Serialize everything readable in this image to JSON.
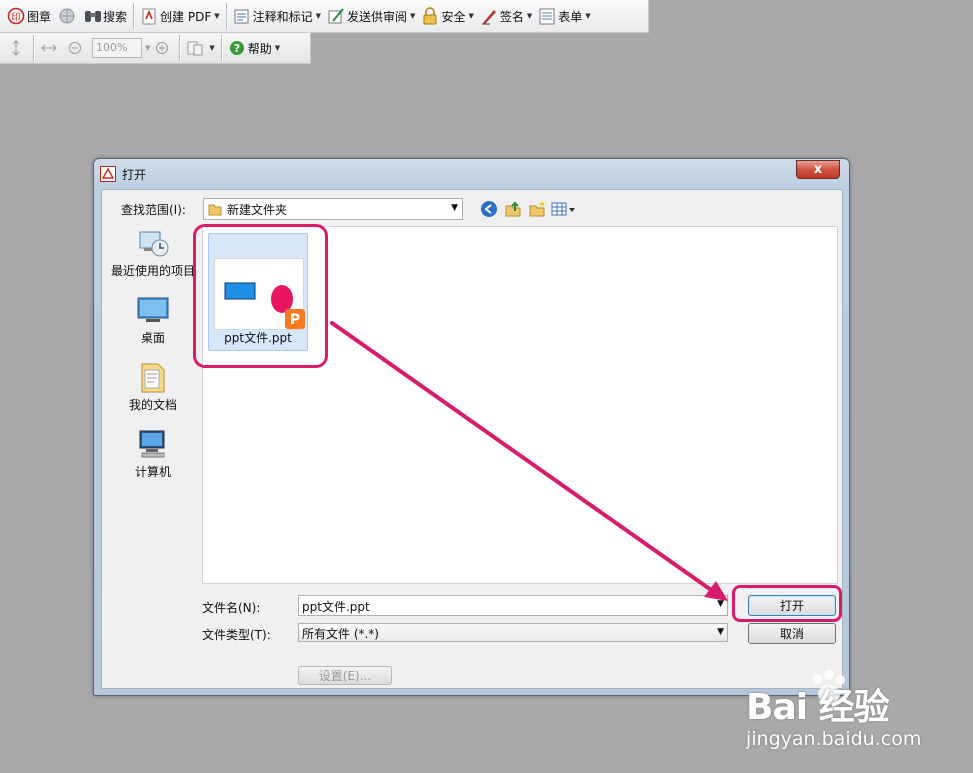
{
  "toolbar_top": {
    "items": [
      {
        "label": "图章",
        "icon": "stamp-icon"
      },
      {
        "label": "",
        "icon": "globe-icon"
      },
      {
        "label": "搜索",
        "icon": "binoculars-icon"
      },
      {
        "label": "创建 PDF",
        "icon": "create-pdf-icon",
        "dropdown": true
      },
      {
        "label": "注释和标记",
        "icon": "comment-icon",
        "dropdown": true
      },
      {
        "label": "发送供审阅",
        "icon": "review-icon",
        "dropdown": true
      },
      {
        "label": "安全",
        "icon": "lock-icon",
        "dropdown": true
      },
      {
        "label": "签名",
        "icon": "pen-icon",
        "dropdown": true
      },
      {
        "label": "表单",
        "icon": "form-icon",
        "dropdown": true
      }
    ]
  },
  "toolbar_second": {
    "zoom_value": "100%",
    "help_label": "帮助"
  },
  "dialog": {
    "title": "打开",
    "close_label": "x",
    "look_in_label": "查找范围(I):",
    "look_in_value": "新建文件夹",
    "places": [
      {
        "label": "最近使用的项目",
        "icon": "recent-items-icon"
      },
      {
        "label": "桌面",
        "icon": "desktop-icon"
      },
      {
        "label": "我的文档",
        "icon": "my-documents-icon"
      },
      {
        "label": "计算机",
        "icon": "computer-icon"
      }
    ],
    "files": [
      {
        "name": "ppt文件.ppt",
        "icon": "ppt-file-icon"
      }
    ],
    "file_name_label": "文件名(N):",
    "file_name_value": "ppt文件.ppt",
    "file_type_label": "文件类型(T):",
    "file_type_value": "所有文件 (*.*)",
    "open_button": "打开",
    "cancel_button": "取消",
    "setup_button": "设置(E)...",
    "highlight_color": "#d81b6a"
  },
  "watermark": {
    "logo_text": "Bai 经验",
    "url": "jingyan.baidu.com"
  }
}
